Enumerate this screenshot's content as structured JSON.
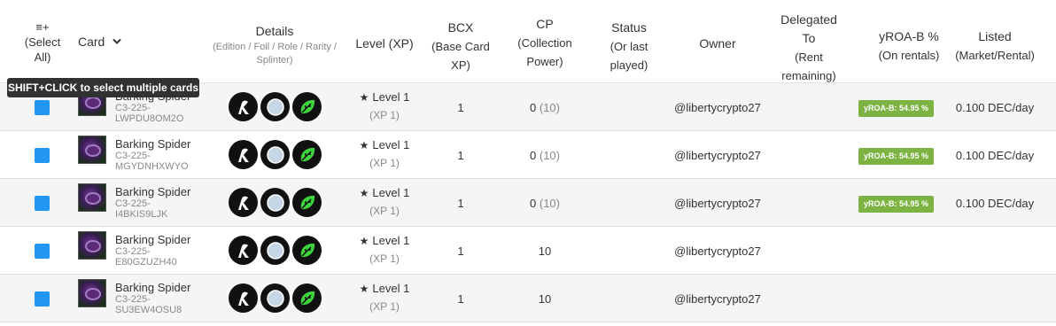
{
  "header": {
    "select": {
      "icon_text": "≡+",
      "line1": "(Select",
      "line2": "All)"
    },
    "card": {
      "label": "Card"
    },
    "details": {
      "label": "Details",
      "sub1": "(Edition / Foil / Role / Rarity /",
      "sub2": "Splinter)"
    },
    "level": {
      "label": "Level (XP)"
    },
    "bcx": {
      "label": "BCX",
      "sub1": "(Base Card",
      "sub2": "XP)"
    },
    "cp": {
      "label": "CP",
      "sub1": "(Collection",
      "sub2": "Power)"
    },
    "status": {
      "label": "Status",
      "sub1": "(Or last",
      "sub2": "played)"
    },
    "owner": {
      "label": "Owner"
    },
    "delegated": {
      "line1": "Delegated",
      "line2": "To",
      "line3": "(Rent",
      "line4": "remaining)"
    },
    "yroa": {
      "label": "yROA-B %",
      "sub": "(On rentals)"
    },
    "listed": {
      "label": "Listed",
      "sub": "(Market/Rental)"
    }
  },
  "tooltip": "SHIFT+CLICK to select multiple cards",
  "rows": [
    {
      "name": "Barking Spider",
      "uid_line1": "C3-225-",
      "uid_line2": "LWPDU8OM2O",
      "level": "Level 1",
      "xp": "(XP 1)",
      "bcx": "1",
      "cp_value": "0",
      "cp_muted": "(10)",
      "owner": "@libertycrypto27",
      "yroa": "yROA-B: 54.95 %",
      "listed": "0.100 DEC/day"
    },
    {
      "name": "Barking Spider",
      "uid_line1": "C3-225-",
      "uid_line2": "MGYDNHXWYO",
      "level": "Level 1",
      "xp": "(XP 1)",
      "bcx": "1",
      "cp_value": "0",
      "cp_muted": "(10)",
      "owner": "@libertycrypto27",
      "yroa": "yROA-B: 54.95 %",
      "listed": "0.100 DEC/day"
    },
    {
      "name": "Barking Spider",
      "uid_line1": "C3-225-",
      "uid_line2": "I4BKIS9LJK",
      "level": "Level 1",
      "xp": "(XP 1)",
      "bcx": "1",
      "cp_value": "0",
      "cp_muted": "(10)",
      "owner": "@libertycrypto27",
      "yroa": "yROA-B: 54.95 %",
      "listed": "0.100 DEC/day"
    },
    {
      "name": "Barking Spider",
      "uid_line1": "C3-225-",
      "uid_line2": "E80GZUZH40",
      "level": "Level 1",
      "xp": "(XP 1)",
      "bcx": "1",
      "cp_value": "10",
      "cp_muted": "",
      "owner": "@libertycrypto27",
      "yroa": "",
      "listed": ""
    },
    {
      "name": "Barking Spider",
      "uid_line1": "C3-225-",
      "uid_line2": "SU3EW4OSU8",
      "level": "Level 1",
      "xp": "(XP 1)",
      "bcx": "1",
      "cp_value": "10",
      "cp_muted": "",
      "owner": "@libertycrypto27",
      "yroa": "",
      "listed": ""
    }
  ],
  "colors": {
    "checkbox": "#2196f3",
    "yroa_badge": "#7cb342",
    "tooltip_bg": "#323232",
    "earth_splinter": "#3fd43f"
  },
  "icons": {
    "edition": "chaos-legion-icon",
    "foil": "regular-foil-icon",
    "splinter": "earth-splinter-icon",
    "sort": "chevron-down-icon",
    "level": "star-icon"
  }
}
